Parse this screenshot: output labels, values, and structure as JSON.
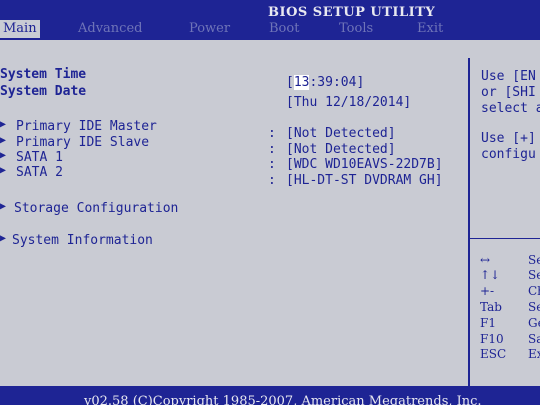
{
  "title": "BIOS SETUP UTILITY",
  "menu": [
    {
      "label": "Main",
      "active": true
    },
    {
      "label": "Advanced",
      "active": false
    },
    {
      "label": "Power",
      "active": false
    },
    {
      "label": "Boot",
      "active": false
    },
    {
      "label": "Tools",
      "active": false
    },
    {
      "label": "Exit",
      "active": false
    }
  ],
  "system_time": {
    "label": "System Time",
    "hour": "13",
    "rest": ":39:04]",
    "open": "["
  },
  "system_date": {
    "label": "System Date",
    "value": "[Thu 12/18/2014]"
  },
  "devices": [
    {
      "arrow": "▶",
      "label": "Primary IDE Master",
      "sep": ":",
      "value": "[Not Detected]"
    },
    {
      "arrow": "▶",
      "label": "Primary IDE Slave",
      "sep": ":",
      "value": "[Not Detected]"
    },
    {
      "arrow": "▶",
      "label": "SATA 1",
      "sep": ":",
      "value": "[WDC WD10EAVS-22D7B]"
    },
    {
      "arrow": "▶",
      "label": "SATA 2",
      "sep": ":",
      "value": "[HL-DT-ST DVDRAM GH]"
    }
  ],
  "submenus": [
    {
      "arrow": "▶",
      "label": "Storage Configuration"
    },
    {
      "arrow": "▶",
      "label": "System Information"
    }
  ],
  "help": {
    "lines": [
      "Use [EN",
      "or [SHI",
      "select a",
      "",
      "Use [+]",
      "configu"
    ]
  },
  "keys": [
    {
      "key": "↔",
      "desc": "Se"
    },
    {
      "key": "↑↓",
      "desc": "Se"
    },
    {
      "key": "+-",
      "desc": "Ch"
    },
    {
      "key": "Tab",
      "desc": "Se"
    },
    {
      "key": "F1",
      "desc": "Ge"
    },
    {
      "key": "F10",
      "desc": "Sa"
    },
    {
      "key": "ESC",
      "desc": "Ex"
    }
  ],
  "footer": "v02.58 (C)Copyright 1985-2007, American Megatrends, Inc."
}
